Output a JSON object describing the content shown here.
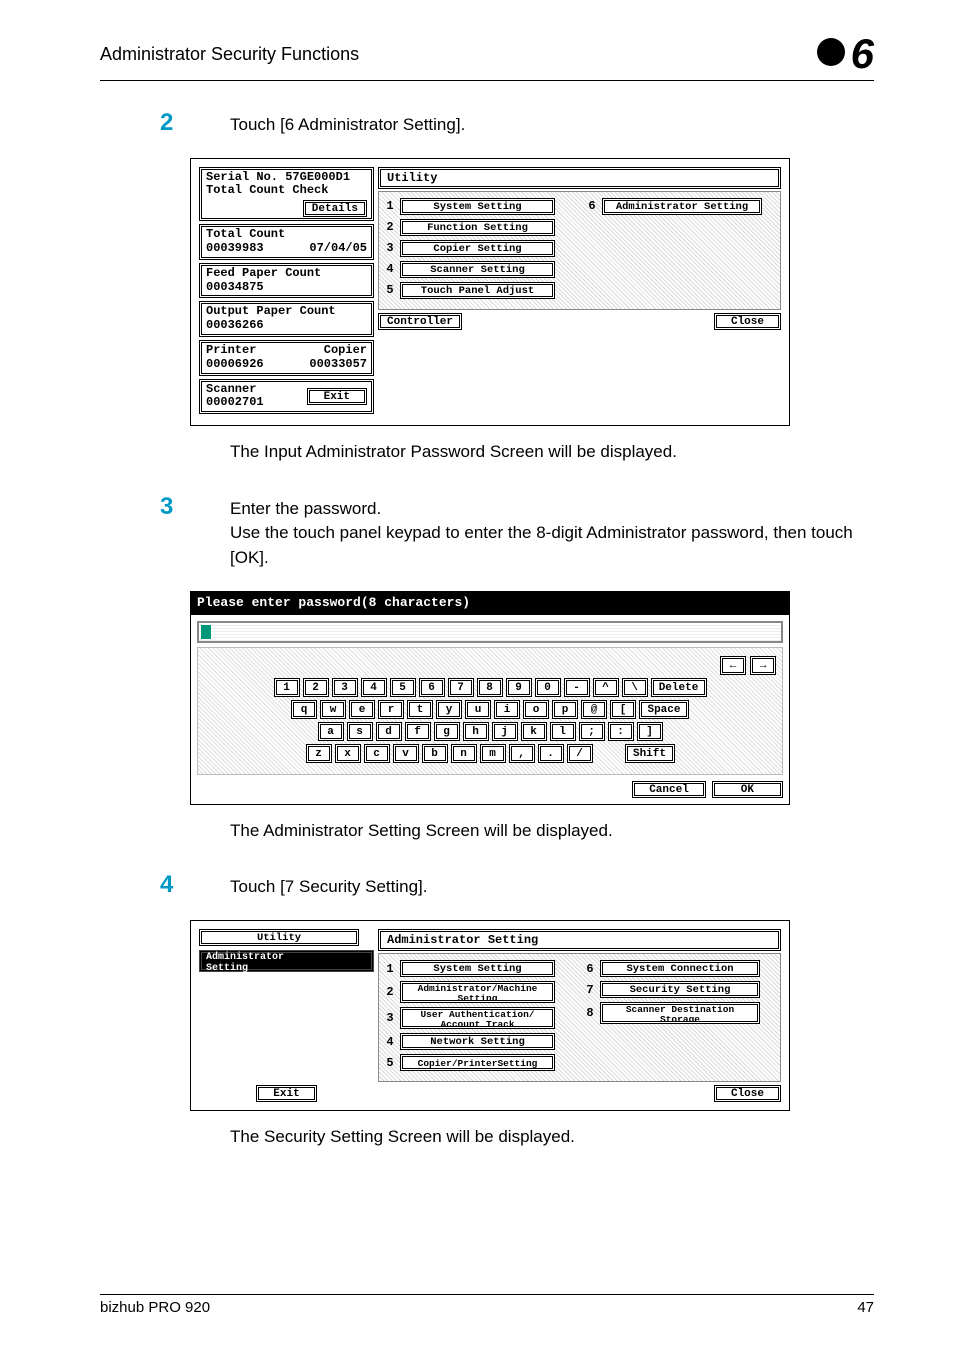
{
  "header": {
    "title": "Administrator Security Functions",
    "chapter_num": "6"
  },
  "step2": {
    "num": "2",
    "text": "Touch [6 Administrator Setting]."
  },
  "screen1": {
    "serial_line1": "Serial No. 57GE000D1",
    "serial_line2": "Total Count Check",
    "details_btn": "Details",
    "total_count_label": "Total Count",
    "total_count_val": "00039983",
    "total_count_date": "07/04/05",
    "feed_label": "Feed Paper Count",
    "feed_val": "00034875",
    "output_label": "Output Paper Count",
    "output_val": "00036266",
    "printer_label": "Printer",
    "copier_label": "Copier",
    "printer_val": "00006926",
    "copier_val": "00033057",
    "scanner_label": "Scanner",
    "scanner_val": "00002701",
    "exit_btn": "Exit",
    "utility_title": "Utility",
    "menu": [
      {
        "n": "1",
        "label": "System Setting"
      },
      {
        "n": "2",
        "label": "Function Setting"
      },
      {
        "n": "3",
        "label": "Copier Setting"
      },
      {
        "n": "4",
        "label": "Scanner Setting"
      },
      {
        "n": "5",
        "label": "Touch Panel Adjust"
      }
    ],
    "menu6_n": "6",
    "menu6_label": "Administrator Setting",
    "controller_btn": "Controller",
    "close_btn": "Close"
  },
  "after2": "The Input Administrator Password Screen will be displayed.",
  "step3": {
    "num": "3",
    "line1": "Enter the password.",
    "line2": "Use the touch panel keypad to enter the 8-digit Administrator password, then touch [OK]."
  },
  "pw": {
    "title": "Please enter password(8 characters)",
    "arrow_left": "←",
    "arrow_right": "→",
    "delete": "Delete",
    "row1": [
      "1",
      "2",
      "3",
      "4",
      "5",
      "6",
      "7",
      "8",
      "9",
      "0",
      "-",
      "^",
      "\\"
    ],
    "row2": [
      "q",
      "w",
      "e",
      "r",
      "t",
      "y",
      "u",
      "i",
      "o",
      "p",
      "@",
      "["
    ],
    "space": "Space",
    "row3": [
      "a",
      "s",
      "d",
      "f",
      "g",
      "h",
      "j",
      "k",
      "l",
      ";",
      ":",
      "]"
    ],
    "row4": [
      "z",
      "x",
      "c",
      "v",
      "b",
      "n",
      "m",
      ",",
      ".",
      "/"
    ],
    "shift": "Shift",
    "cancel": "Cancel",
    "ok": "OK"
  },
  "after3": "The Administrator Setting Screen will be displayed.",
  "step4": {
    "num": "4",
    "text": "Touch [7 Security Setting]."
  },
  "screen3": {
    "utility_btn": "Utility",
    "admin_btn_l1": "Administrator",
    "admin_btn_l2": "Setting",
    "exit_btn": "Exit",
    "title": "Administrator Setting",
    "left_menu": [
      {
        "n": "1",
        "label": "System Setting"
      },
      {
        "n": "2",
        "l1": "Administrator/Machine",
        "l2": "Setting"
      },
      {
        "n": "3",
        "l1": "User Authentication/",
        "l2": "Account Track"
      },
      {
        "n": "4",
        "label": "Network Setting"
      },
      {
        "n": "5",
        "label": "Copier/PrinterSetting"
      }
    ],
    "right_menu": [
      {
        "n": "6",
        "label": "System Connection"
      },
      {
        "n": "7",
        "label": "Security Setting"
      },
      {
        "n": "8",
        "l1": "Scanner Destination",
        "l2": "Storage"
      }
    ],
    "close_btn": "Close"
  },
  "after4": "The Security Setting Screen will be displayed.",
  "footer": {
    "product": "bizhub PRO 920",
    "page": "47"
  }
}
